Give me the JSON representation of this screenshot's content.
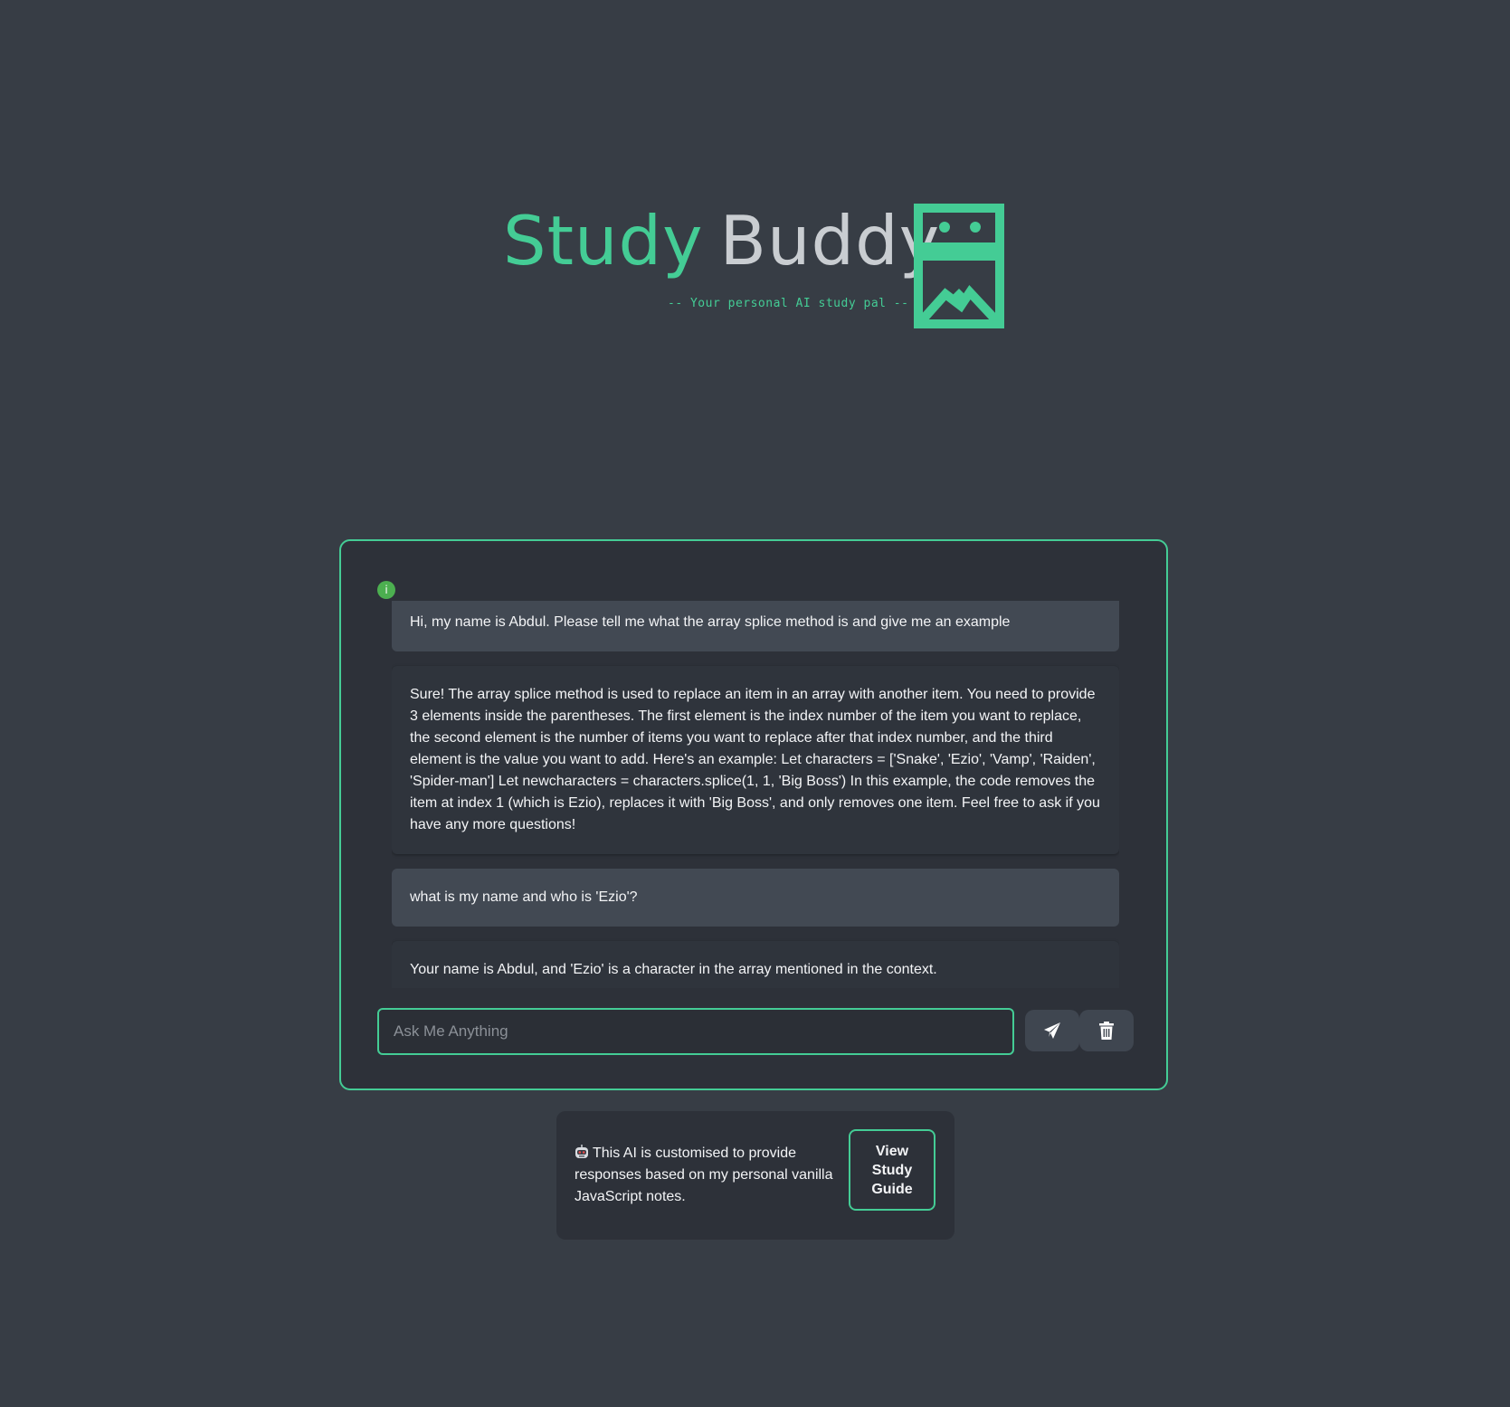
{
  "header": {
    "title_part1": "Study",
    "title_part2": "Buddy",
    "tagline": "-- Your personal AI study pal --",
    "brand_color": "#44cc95",
    "title_secondary_color": "#c9cdd1",
    "logo_icon": "robot-logo-icon"
  },
  "chat": {
    "info_badge": "i",
    "messages": [
      {
        "role": "user",
        "text": "Hi, my name is Abdul. Please tell me what the array splice method is and give me an example"
      },
      {
        "role": "assistant",
        "text": "Sure! The array splice method is used to replace an item in an array with another item. You need to provide 3 elements inside the parentheses. The first element is the index number of the item you want to replace, the second element is the number of items you want to replace after that index number, and the third element is the value you want to add. Here's an example: Let characters = ['Snake', 'Ezio', 'Vamp', 'Raiden', 'Spider-man'] Let newcharacters = characters.splice(1, 1, 'Big Boss') In this example, the code removes the item at index 1 (which is Ezio), replaces it with 'Big Boss', and only removes one item. Feel free to ask if you have any more questions!"
      },
      {
        "role": "user",
        "text": "what is my name and who is 'Ezio'?"
      },
      {
        "role": "assistant",
        "text": "Your name is Abdul, and 'Ezio' is a character in the array mentioned in the context."
      }
    ],
    "input": {
      "placeholder": "Ask Me Anything",
      "value": ""
    },
    "send_icon": "paper-plane-icon",
    "delete_icon": "trash-icon"
  },
  "info_panel": {
    "emoji_icon": "robot-emoji-icon",
    "text": "This AI is customised to provide responses based on my personal vanilla JavaScript notes.",
    "button_label": "View Study Guide"
  }
}
